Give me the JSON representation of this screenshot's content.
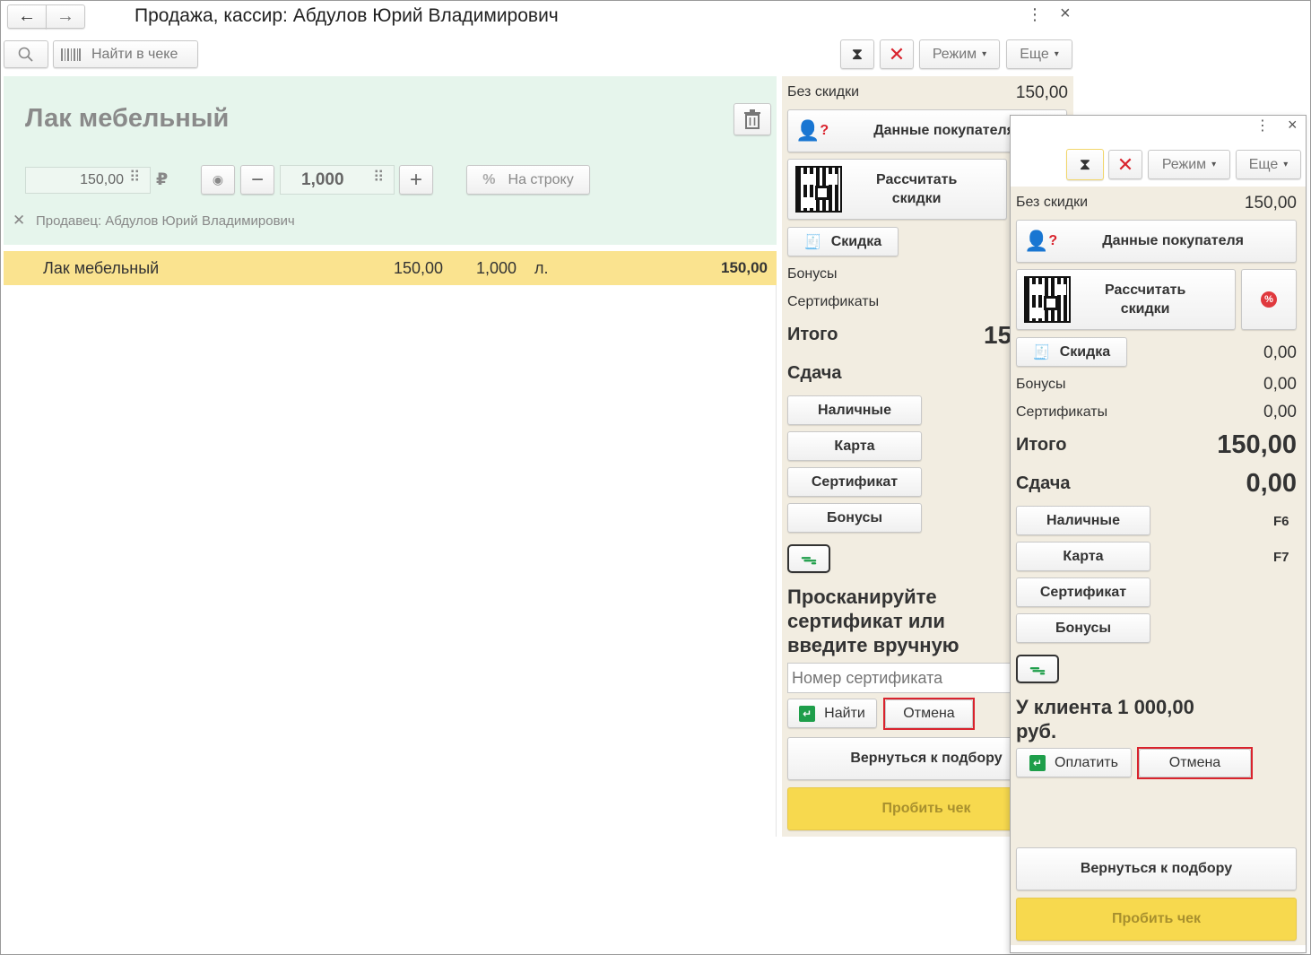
{
  "window": {
    "title": "Продажа, кассир: Абдулов Юрий Владимирович",
    "more_icon": "⋮",
    "close_icon": "×"
  },
  "toolbar": {
    "search_icon": "search-icon",
    "find_in_receipt_label": "Найти в чеке",
    "mode_label": "Режим",
    "more_label": "Еще"
  },
  "item_card": {
    "name": "Лак мебельный",
    "price": "150,00",
    "currency": "₽",
    "quantity": "1,000",
    "per_line_label": "На строку",
    "seller": "Продавец: Абдулов Юрий Владимирович"
  },
  "receipt_rows": [
    {
      "name": "Лак мебельный",
      "price": "150,00",
      "qty": "1,000",
      "unit": "л.",
      "sum": "150,00"
    }
  ],
  "panel_back": {
    "no_discount_label": "Без скидки",
    "no_discount_value": "150,00",
    "customer_data_label": "Данные покупателя",
    "calc_discounts_label_1": "Рассчитать",
    "calc_discounts_label_2": "скидки",
    "discount_label": "Скидка",
    "bonuses_label": "Бонусы",
    "certificates_label": "Сертификаты",
    "total_label": "Итого",
    "total_value_partial": "15",
    "change_label": "Сдача",
    "pay_buttons": [
      "Наличные",
      "Карта",
      "Сертификат",
      "Бонусы"
    ],
    "scan_prompt_1": "Просканируйте",
    "scan_prompt_2": "сертификат или",
    "scan_prompt_3": "введите вручную",
    "cert_placeholder": "Номер сертификата",
    "find_label": "Найти",
    "cancel_label": "Отмена",
    "back_to_selection_label": "Вернуться к подбору",
    "print_receipt_label": "Пробить чек"
  },
  "panel_front": {
    "mode_label": "Режим",
    "more_label": "Еще",
    "no_discount_label": "Без скидки",
    "no_discount_value": "150,00",
    "customer_data_label": "Данные покупателя",
    "calc_discounts_label_1": "Рассчитать",
    "calc_discounts_label_2": "скидки",
    "discount_label": "Скидка",
    "discount_value": "0,00",
    "bonuses_label": "Бонусы",
    "bonuses_value": "0,00",
    "certificates_label": "Сертификаты",
    "certificates_value": "0,00",
    "total_label": "Итого",
    "total_value": "150,00",
    "change_label": "Сдача",
    "change_value": "0,00",
    "pay_buttons": [
      "Наличные",
      "Карта",
      "Сертификат",
      "Бонусы"
    ],
    "hotkeys": [
      "F6",
      "F7"
    ],
    "client_has_1": "У клиента 1 000,00",
    "client_has_2": "руб.",
    "pay_label": "Оплатить",
    "cancel_label": "Отмена",
    "back_to_selection_label": "Вернуться к подбору",
    "print_receipt_label": "Пробить чек"
  },
  "colors": {
    "item_card_bg": "#e6f5ec",
    "selected_row_bg": "#fae38f",
    "panel_bg": "#f2ede1",
    "print_button_bg": "#f7d94e",
    "highlight_border": "#d9232d"
  }
}
